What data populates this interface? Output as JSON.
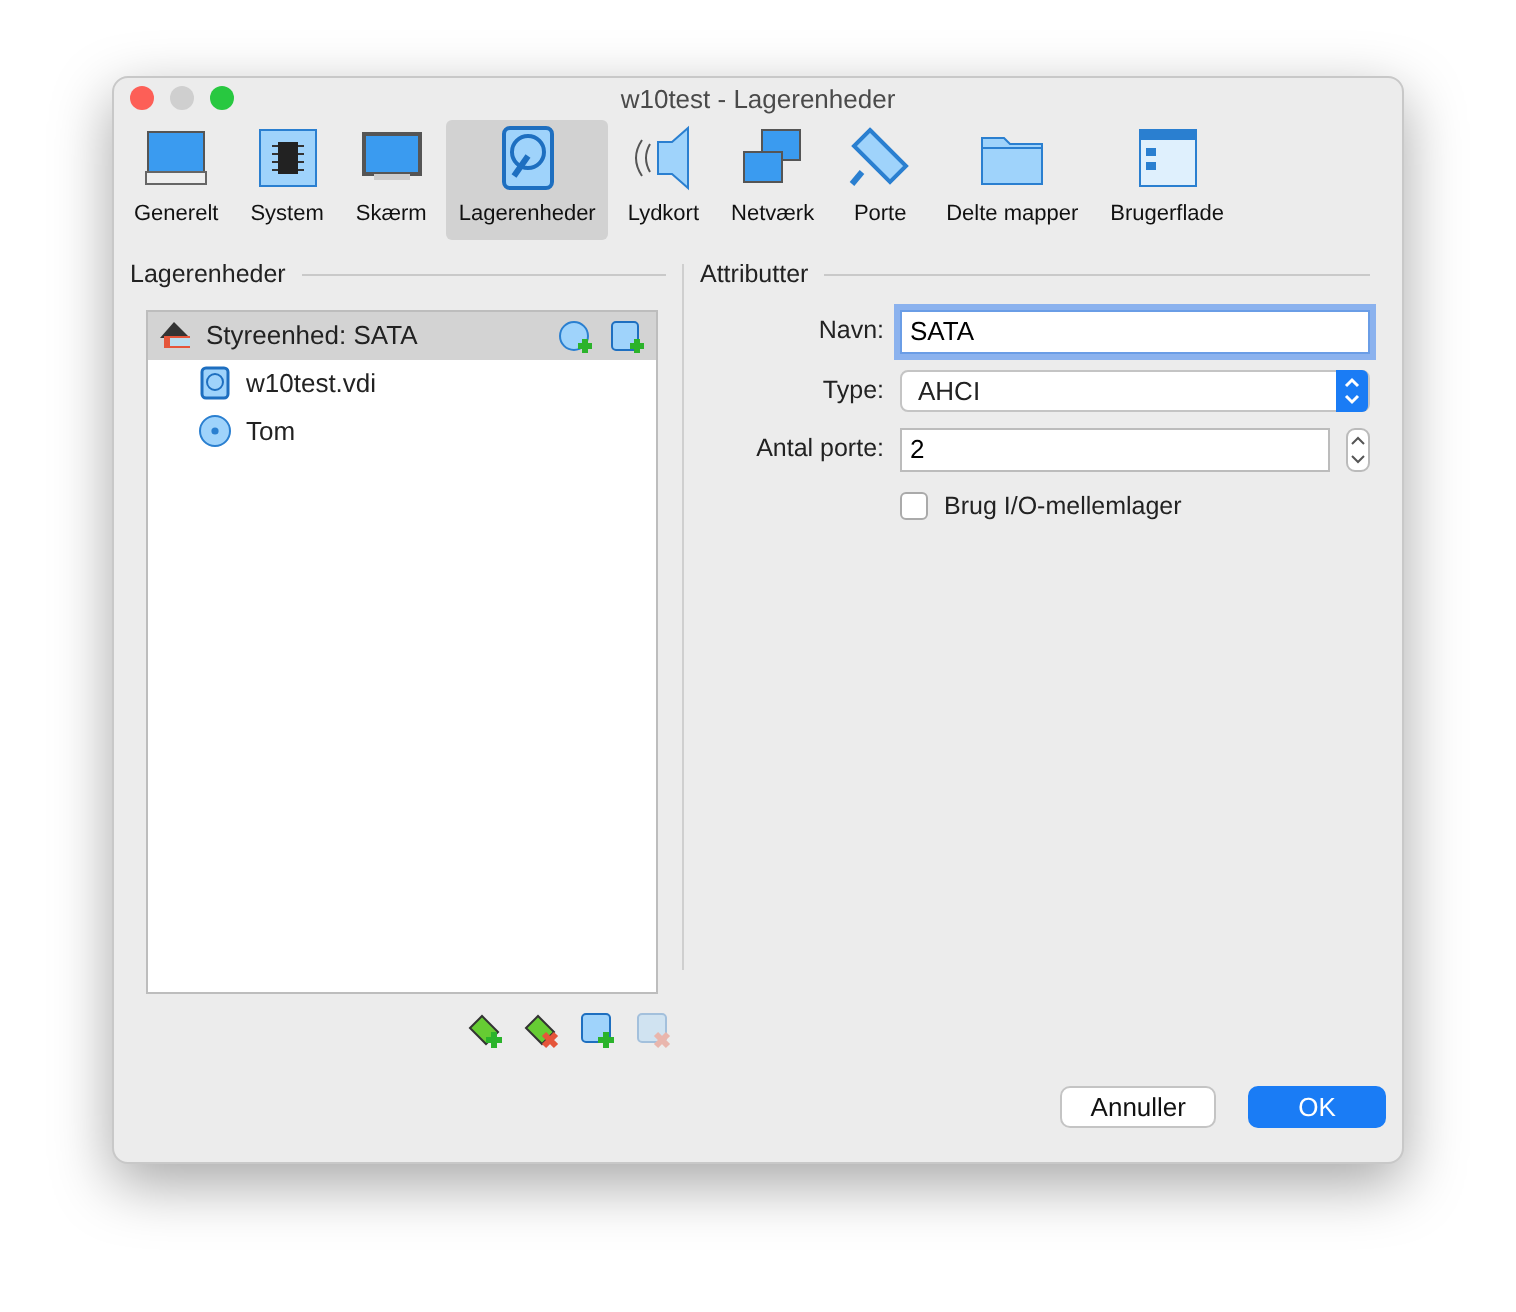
{
  "window": {
    "title": "w10test - Lagerenheder"
  },
  "tabs": [
    {
      "label": "Generelt",
      "kind": "general",
      "selected": false
    },
    {
      "label": "System",
      "kind": "chip",
      "selected": false
    },
    {
      "label": "Skærm",
      "kind": "display",
      "selected": false
    },
    {
      "label": "Lagerenheder",
      "kind": "storage",
      "selected": true
    },
    {
      "label": "Lydkort",
      "kind": "audio",
      "selected": false
    },
    {
      "label": "Netværk",
      "kind": "network",
      "selected": false
    },
    {
      "label": "Porte",
      "kind": "ports",
      "selected": false
    },
    {
      "label": "Delte mapper",
      "kind": "folder",
      "selected": false
    },
    {
      "label": "Brugerflade",
      "kind": "ui",
      "selected": false
    }
  ],
  "storage": {
    "heading": "Lagerenheder",
    "tree": [
      {
        "label": "Styreenhed: SATA",
        "kind": "controller",
        "selected": true,
        "children": [
          {
            "label": "w10test.vdi",
            "kind": "hdd",
            "selected": false
          },
          {
            "label": "Tom",
            "kind": "optical",
            "selected": false
          }
        ]
      }
    ],
    "tools": [
      {
        "kind": "add-controller",
        "disabled": false
      },
      {
        "kind": "remove-controller",
        "disabled": false
      },
      {
        "kind": "add-attachment",
        "disabled": false
      },
      {
        "kind": "remove-attachment",
        "disabled": true
      }
    ]
  },
  "attributes": {
    "heading": "Attributter",
    "name": {
      "label": "Navn:",
      "value": "SATA",
      "focused": true
    },
    "type": {
      "label": "Type:",
      "value": "AHCI"
    },
    "ports": {
      "label": "Antal porte:",
      "value": "2"
    },
    "cache": {
      "label": "Brug I/O-mellemlager",
      "checked": false
    }
  },
  "buttons": [
    {
      "label": "Annuller",
      "kind": "secondary"
    },
    {
      "label": "OK",
      "kind": "primary"
    }
  ]
}
